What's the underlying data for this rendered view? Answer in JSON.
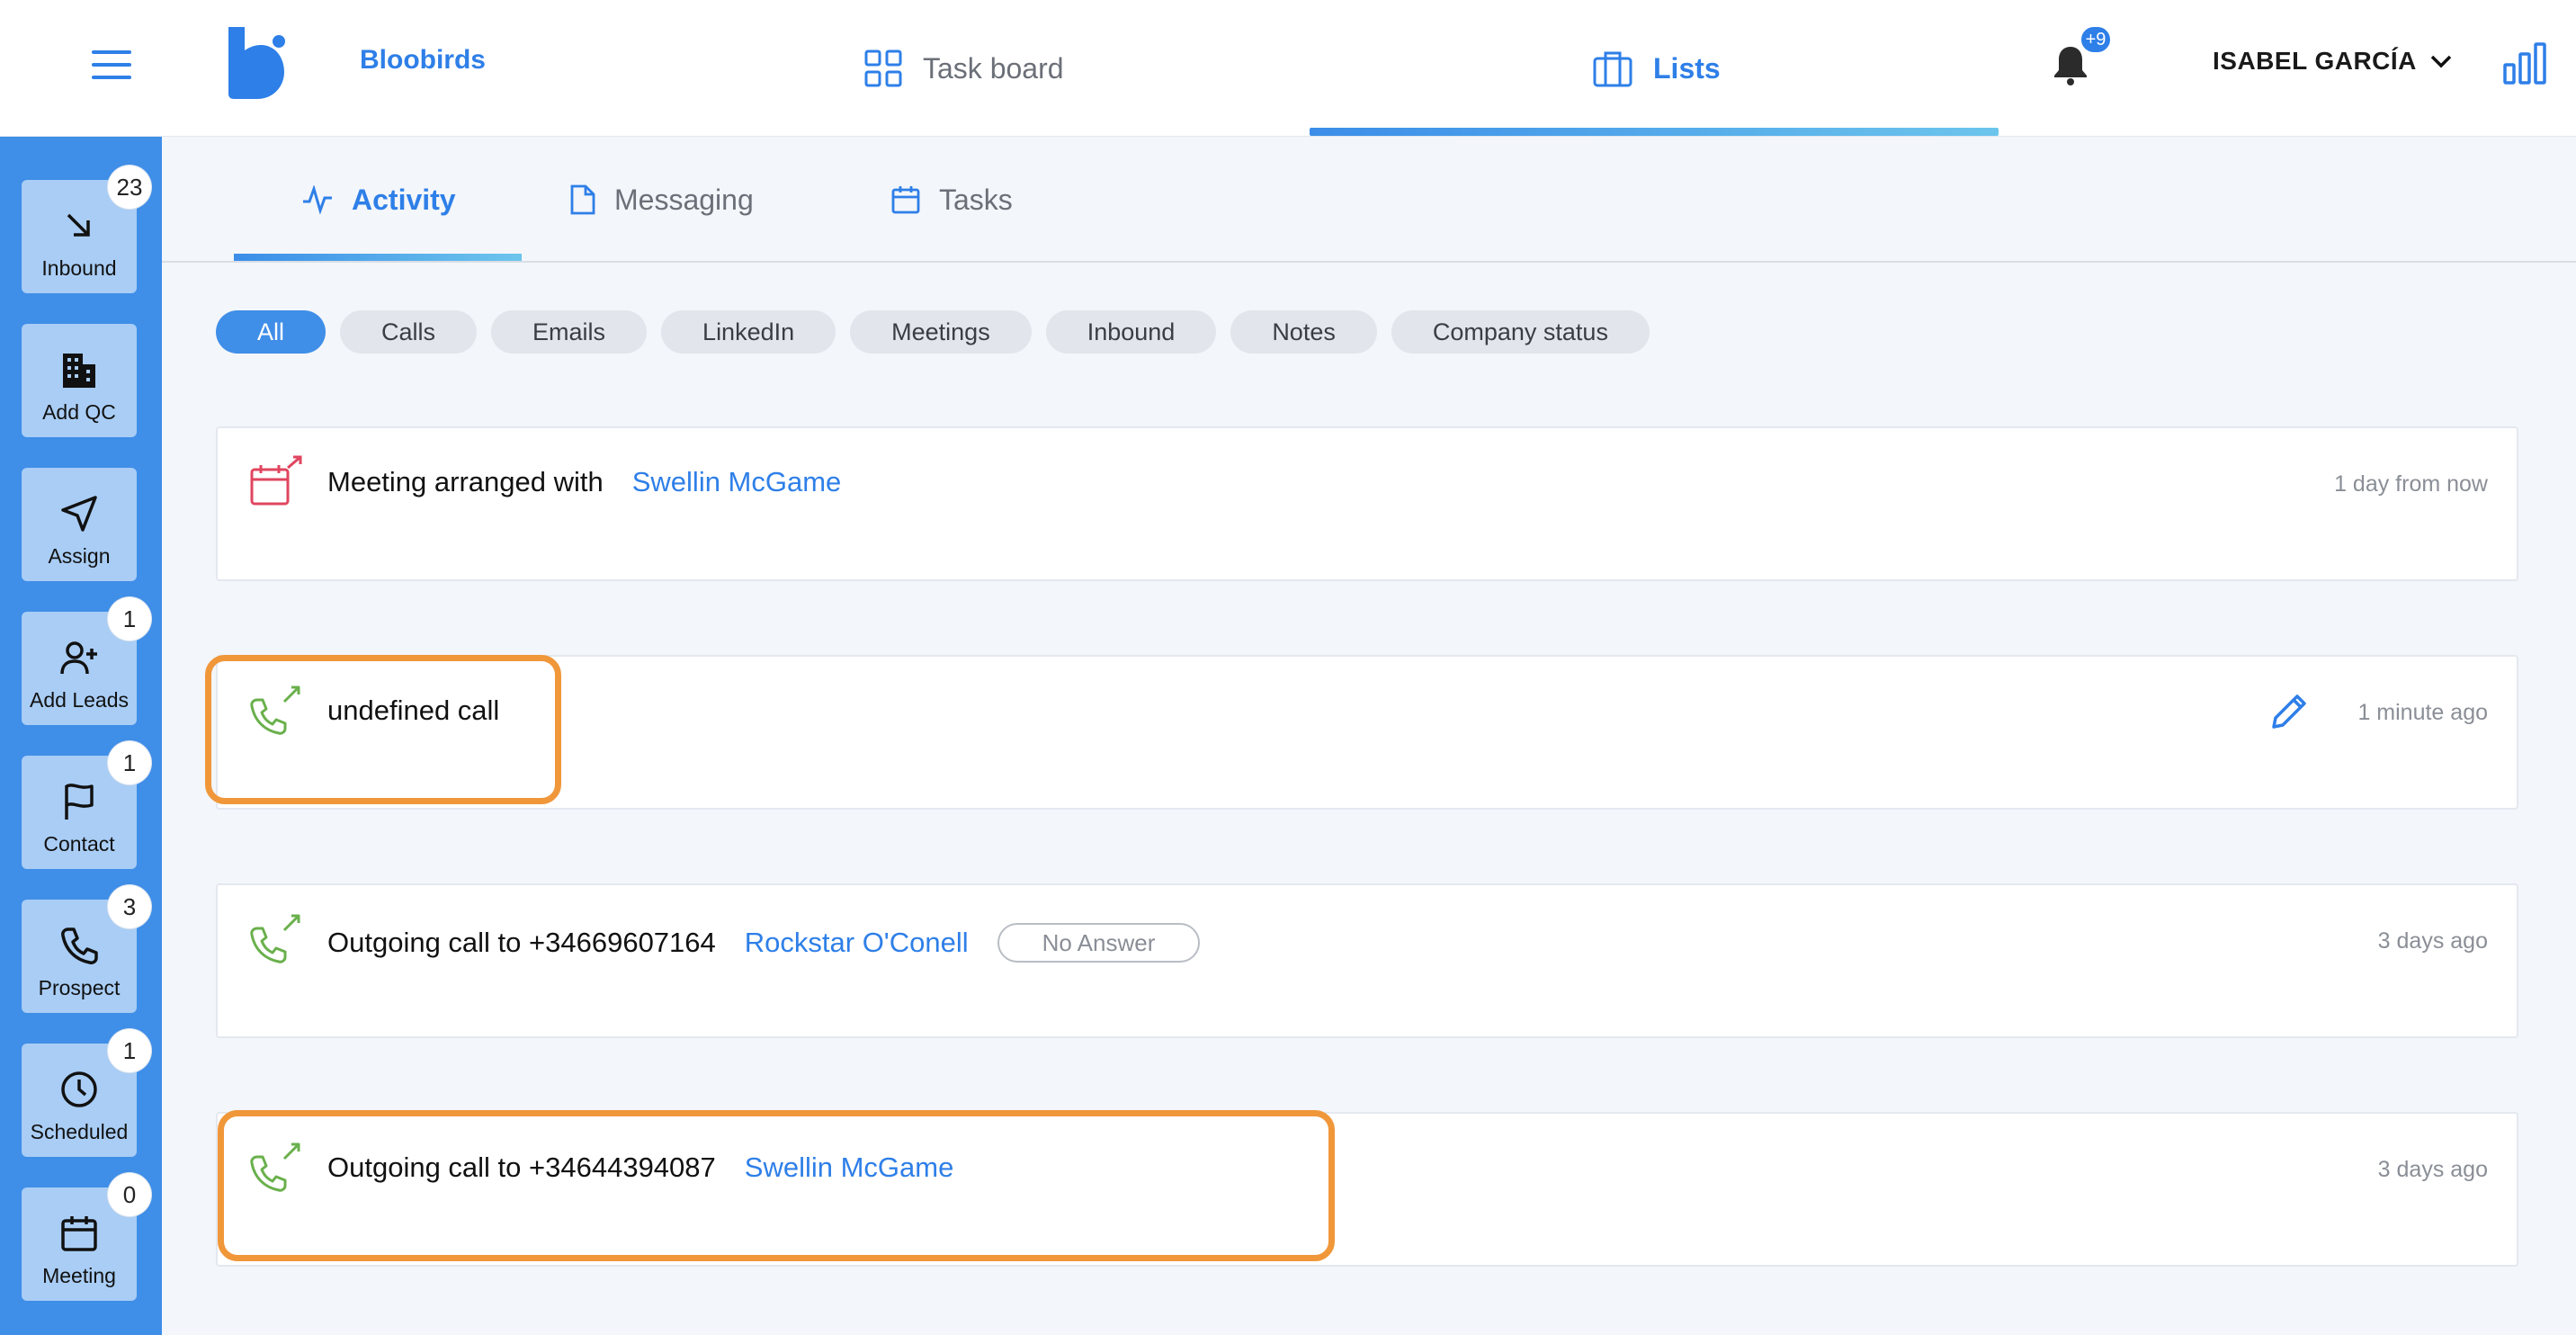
{
  "header": {
    "brand": "Bloobirds",
    "nav": [
      {
        "label": "Task board",
        "active": false
      },
      {
        "label": "Lists",
        "active": true
      }
    ],
    "notifications_badge": "+9",
    "user_name": "ISABEL GARCÍA"
  },
  "sidebar": {
    "items": [
      {
        "label": "Inbound",
        "badge": "23",
        "icon": "arrow-down-right-icon"
      },
      {
        "label": "Add QC",
        "badge": "",
        "icon": "building-icon"
      },
      {
        "label": "Assign",
        "badge": "",
        "icon": "send-icon"
      },
      {
        "label": "Add Leads",
        "badge": "1",
        "icon": "user-plus-icon"
      },
      {
        "label": "Contact",
        "badge": "1",
        "icon": "flag-icon"
      },
      {
        "label": "Prospect",
        "badge": "3",
        "icon": "phone-icon"
      },
      {
        "label": "Scheduled",
        "badge": "1",
        "icon": "clock-icon"
      },
      {
        "label": "Meeting",
        "badge": "0",
        "icon": "calendar-icon"
      }
    ]
  },
  "subtabs": [
    {
      "label": "Activity",
      "active": true
    },
    {
      "label": "Messaging",
      "active": false
    },
    {
      "label": "Tasks",
      "active": false
    }
  ],
  "filters": {
    "chips": [
      "All",
      "Calls",
      "Emails",
      "LinkedIn",
      "Meetings",
      "Inbound",
      "Notes",
      "Company status"
    ],
    "selected": "All"
  },
  "activities": [
    {
      "type": "meeting",
      "text": "Meeting arranged with",
      "link": "Swellin McGame",
      "status": "",
      "time": "1 day from now"
    },
    {
      "type": "call",
      "text": "undefined call",
      "link": "",
      "status": "",
      "time": "1 minute ago"
    },
    {
      "type": "call",
      "text": "Outgoing call to +34669607164",
      "link": "Rockstar O'Conell",
      "status": "No Answer",
      "time": "3 days ago"
    },
    {
      "type": "call",
      "text": "Outgoing call to +34644394087",
      "link": "Swellin McGame",
      "status": "",
      "time": "3 days ago"
    }
  ],
  "colors": {
    "accent": "#2e7fe8",
    "sidebar": "#3f8ee8",
    "sidebar_button": "#a9cdf5",
    "call_icon": "#6ab04c",
    "meeting_icon": "#e0455f",
    "highlight": "#f0973a"
  }
}
